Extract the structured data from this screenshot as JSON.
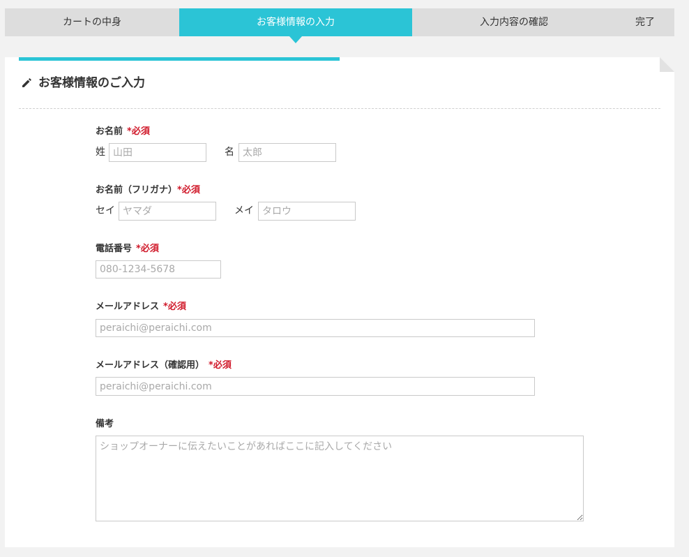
{
  "steps": {
    "cart": "カートの中身",
    "customer_info": "お客様情報の入力",
    "confirm": "入力内容の確認",
    "complete": "完了"
  },
  "form": {
    "section_title": "お客様情報のご入力",
    "required_mark": "*必須",
    "name": {
      "label": "お名前",
      "last_label": "姓",
      "last_placeholder": "山田",
      "first_label": "名",
      "first_placeholder": "太郎"
    },
    "kana": {
      "label": "お名前（フリガナ）",
      "last_label": "セイ",
      "last_placeholder": "ヤマダ",
      "first_label": "メイ",
      "first_placeholder": "タロウ"
    },
    "phone": {
      "label": "電話番号",
      "placeholder": "080-1234-5678"
    },
    "email": {
      "label": "メールアドレス",
      "placeholder": "peraichi@peraichi.com"
    },
    "email_confirm": {
      "label": "メールアドレス（確認用）",
      "placeholder": "peraichi@peraichi.com"
    },
    "notes": {
      "label": "備考",
      "placeholder": "ショップオーナーに伝えたいことがあればここに記入してください"
    }
  },
  "colors": {
    "accent": "#2bc4d6",
    "required": "#d0192a"
  },
  "icons": {
    "title_icon": "pencil-icon",
    "active_step_marker": "triangle-down-icon"
  }
}
